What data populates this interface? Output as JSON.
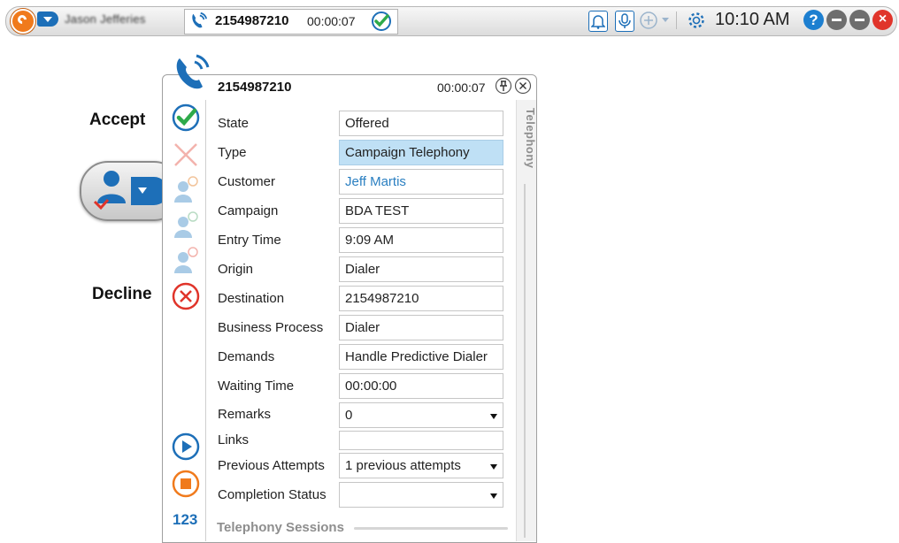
{
  "topbar": {
    "user_name": "Jason Jefferies",
    "active_call": {
      "number": "2154987210",
      "elapsed": "00:00:07"
    },
    "clock": "10:10 AM",
    "help_label": "?",
    "close_label": "×"
  },
  "side_labels": {
    "accept": "Accept",
    "decline": "Decline"
  },
  "panel": {
    "number": "2154987210",
    "elapsed": "00:00:07",
    "side_tab": "Telephony",
    "section_title": "Telephony Sessions",
    "badge_123": "123",
    "fields": [
      {
        "label": "State",
        "value": "Offered"
      },
      {
        "label": "Type",
        "value": "Campaign Telephony"
      },
      {
        "label": "Customer",
        "value": "Jeff Martis"
      },
      {
        "label": "Campaign",
        "value": "BDA TEST"
      },
      {
        "label": "Entry Time",
        "value": "9:09 AM"
      },
      {
        "label": "Origin",
        "value": "Dialer"
      },
      {
        "label": "Destination",
        "value": "2154987210"
      },
      {
        "label": "Business Process",
        "value": "Dialer"
      },
      {
        "label": "Demands",
        "value": "Handle Predictive Dialer"
      },
      {
        "label": "Waiting Time",
        "value": "00:00:00"
      },
      {
        "label": "Remarks",
        "value": "0"
      },
      {
        "label": "Links",
        "value": ""
      },
      {
        "label": "Previous Attempts",
        "value": "1 previous attempts"
      },
      {
        "label": "Completion Status",
        "value": ""
      }
    ]
  },
  "colors": {
    "brand_orange": "#f07a1c",
    "brand_blue": "#1d6fb8",
    "accept_green": "#2eaa4a",
    "decline_red": "#e0342a",
    "highlight": "#bfe0f5",
    "link_blue": "#2a7fc1"
  },
  "icons": [
    "logo-icon",
    "status-icon",
    "phone-ringing-icon",
    "check-circle-icon",
    "bell-icon",
    "microphone-icon",
    "plus-circle-icon",
    "gear-icon",
    "help-icon",
    "minimize-icon",
    "maximize-icon",
    "close-icon",
    "pin-icon",
    "x-icon",
    "consult-icon",
    "transfer-icon",
    "conference-icon",
    "decline-icon",
    "play-icon",
    "stop-icon",
    "agent-icon"
  ]
}
